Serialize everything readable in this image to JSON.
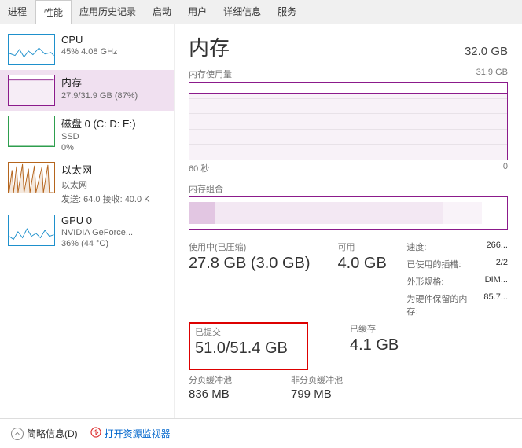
{
  "tabs": [
    "进程",
    "性能",
    "应用历史记录",
    "启动",
    "用户",
    "详细信息",
    "服务"
  ],
  "activeTab": 1,
  "sidebar": [
    {
      "title": "CPU",
      "sub": "45% 4.08 GHz",
      "color": "#1e90cc"
    },
    {
      "title": "内存",
      "sub": "27.9/31.9 GB (87%)",
      "color": "#8b1a8b"
    },
    {
      "title": "磁盘 0 (C: D: E:)",
      "sub": "SSD",
      "sub2": "0%",
      "color": "#2e9e4e"
    },
    {
      "title": "以太网",
      "sub": "以太网",
      "sub2": "发送: 64.0  接收: 40.0 K",
      "color": "#b5651d"
    },
    {
      "title": "GPU 0",
      "sub": "NVIDIA GeForce...",
      "sub2": "36% (44 °C)",
      "color": "#1e90cc"
    }
  ],
  "activeSidebar": 1,
  "main": {
    "title": "内存",
    "total": "32.0 GB",
    "usageLabel": "内存使用量",
    "usageMax": "31.9 GB",
    "xLeft": "60 秒",
    "xRight": "0",
    "compLabel": "内存组合"
  },
  "stats": {
    "inUse": {
      "label": "使用中(已压缩)",
      "value": "27.8 GB (3.0 GB)"
    },
    "available": {
      "label": "可用",
      "value": "4.0 GB"
    },
    "committed": {
      "label": "已提交",
      "value": "51.0/51.4 GB"
    },
    "cached": {
      "label": "已缓存",
      "value": "4.1 GB"
    },
    "pagedPool": {
      "label": "分页缓冲池",
      "value": "836 MB"
    },
    "nonPagedPool": {
      "label": "非分页缓冲池",
      "value": "799 MB"
    }
  },
  "right": {
    "speed": {
      "label": "速度:",
      "value": "266..."
    },
    "slots": {
      "label": "已使用的插槽:",
      "value": "2/2"
    },
    "form": {
      "label": "外形规格:",
      "value": "DIM..."
    },
    "reserved": {
      "label": "为硬件保留的内存:",
      "value": "85.7..."
    }
  },
  "footer": {
    "brief": "简略信息(D)",
    "openMonitor": "打开资源监视器"
  }
}
